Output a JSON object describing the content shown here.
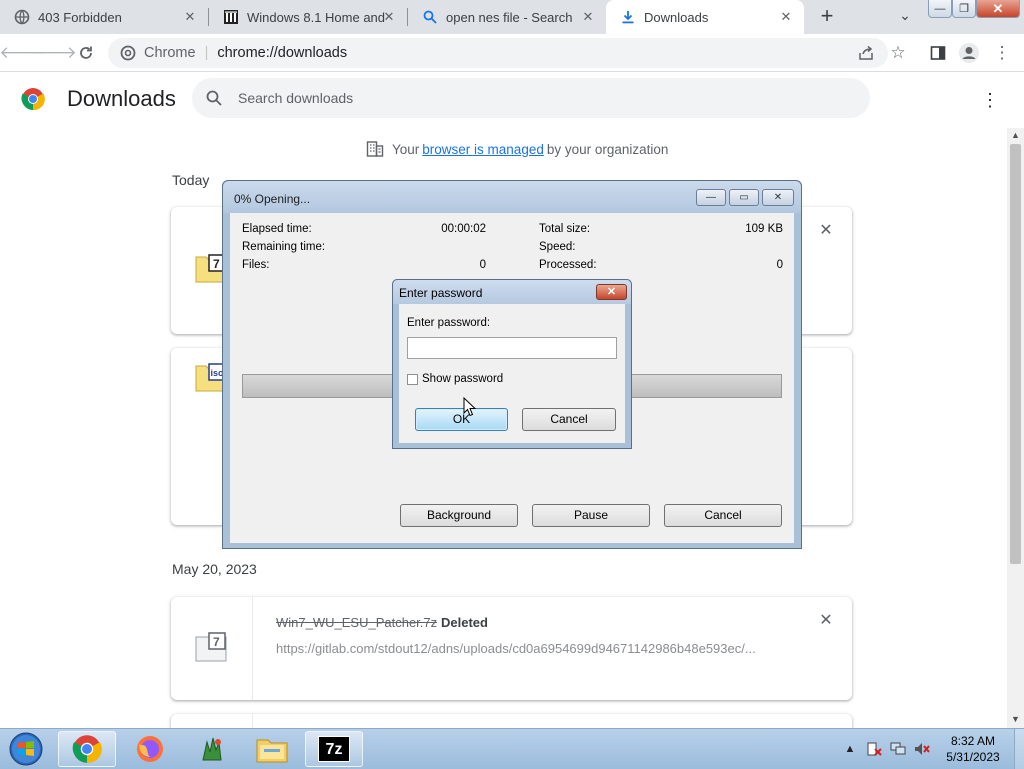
{
  "tabs": [
    {
      "title": "403 Forbidden",
      "icon": "globe-icon"
    },
    {
      "title": "Windows 8.1 Home and I",
      "icon": "archive-icon"
    },
    {
      "title": "open nes file - Search",
      "icon": "search-icon"
    },
    {
      "title": "Downloads",
      "icon": "download-icon",
      "active": true
    }
  ],
  "window_controls": {
    "minimize": "—",
    "maximize": "❐",
    "close": "✕"
  },
  "toolbar": {
    "site_label": "Chrome",
    "url": "chrome://downloads",
    "separator": "|"
  },
  "page": {
    "title": "Downloads",
    "search_placeholder": "Search downloads",
    "managed_prefix": "Your",
    "managed_link": "browser is managed",
    "managed_suffix": "by your organization"
  },
  "downloads": {
    "groups": [
      {
        "date": "Today"
      },
      {
        "date": "May 20, 2023"
      }
    ],
    "items": [
      {
        "file_badge": "7",
        "close": "✕"
      },
      {
        "file_badge": "iso"
      },
      {
        "file_badge": "7",
        "name": "Win7_WU_ESU_Patcher.7z",
        "status": "Deleted",
        "url": "https://gitlab.com/stdout12/adns/uploads/cd0a6954699d94671142986b48e593ec/...",
        "close": "✕"
      }
    ]
  },
  "progress_window": {
    "title": "0% Opening...",
    "elapsed_label": "Elapsed time:",
    "elapsed_value": "00:00:02",
    "remaining_label": "Remaining time:",
    "remaining_value": "",
    "files_label": "Files:",
    "files_value": "0",
    "total_label": "Total size:",
    "total_value": "109 KB",
    "speed_label": "Speed:",
    "speed_value": "",
    "processed_label": "Processed:",
    "processed_value": "0",
    "progress": 0,
    "buttons": {
      "background": "Background",
      "pause": "Pause",
      "cancel": "Cancel"
    }
  },
  "password_dialog": {
    "title": "Enter password",
    "label": "Enter password:",
    "value": "",
    "show_password_label": "Show password",
    "show_password_checked": false,
    "ok": "OK",
    "cancel": "Cancel"
  },
  "taskbar": {
    "apps": [
      "chrome-icon",
      "firefox-icon",
      "app-icon",
      "file-explorer-icon",
      "7zip-icon"
    ],
    "clock_time": "8:32 AM",
    "clock_date": "5/31/2023",
    "seven_zip_label": "7z"
  },
  "colors": {
    "accent": "#1a73e8",
    "tabstrip": "#dee1e6",
    "taskbar": "#a9c4e2"
  }
}
